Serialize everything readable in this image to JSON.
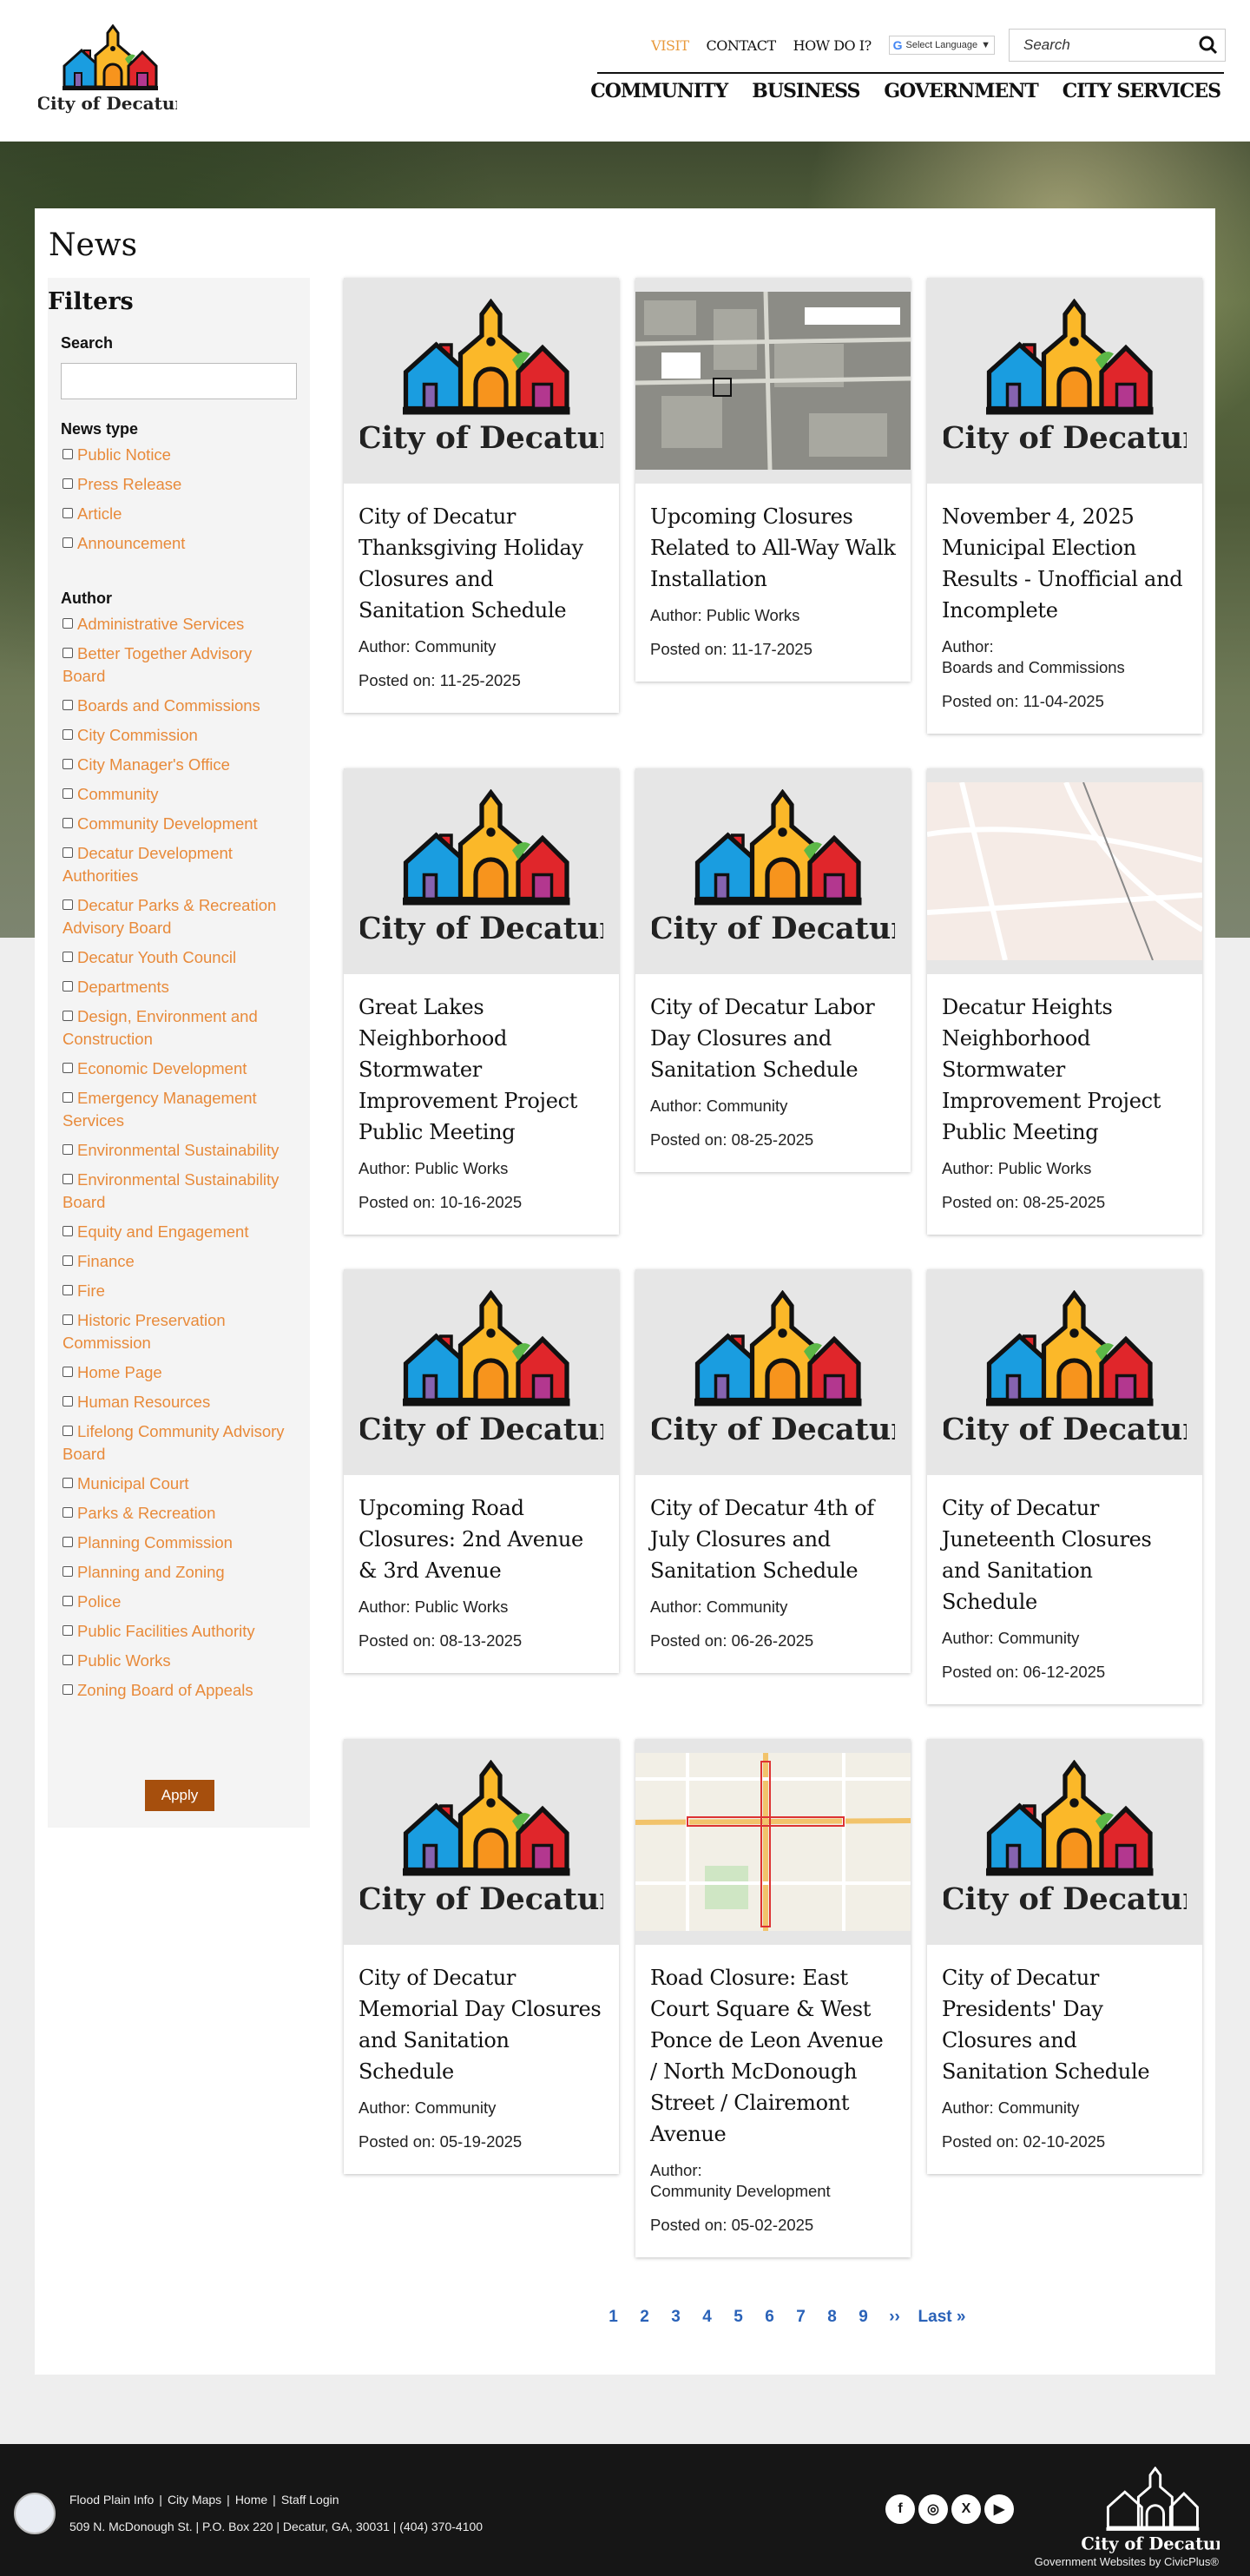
{
  "header": {
    "logo_text": "City of Decatur",
    "utility_links": [
      "VISIT",
      "CONTACT",
      "HOW DO I?"
    ],
    "language_label": "Select Language",
    "search_placeholder": "Search",
    "main_nav": [
      "COMMUNITY",
      "BUSINESS",
      "GOVERNMENT",
      "CITY SERVICES"
    ]
  },
  "page": {
    "title": "News"
  },
  "filters": {
    "title": "Filters",
    "search_label": "Search",
    "search_value": "",
    "news_type_label": "News type",
    "news_types": [
      "Public Notice",
      "Press Release",
      "Article",
      "Announcement"
    ],
    "author_label": "Author",
    "authors": [
      "Administrative Services",
      "Better Together Advisory Board",
      "Boards and Commissions",
      "City Commission",
      "City Manager's Office",
      "Community",
      "Community Development",
      "Decatur Development Authorities",
      "Decatur Parks & Recreation Advisory Board",
      "Decatur Youth Council",
      "Departments",
      "Design, Environment and Construction",
      "Economic Development",
      "Emergency Management Services",
      "Environmental Sustainability",
      "Environmental Sustainability Board",
      "Equity and Engagement",
      "Finance",
      "Fire",
      "Historic Preservation Commission",
      "Home Page",
      "Human Resources",
      "Lifelong Community Advisory Board",
      "Municipal Court",
      "Parks & Recreation",
      "Planning Commission",
      "Planning and Zoning",
      "Police",
      "Public Facilities Authority",
      "Public Works",
      "Zoning Board of Appeals"
    ],
    "apply_label": "Apply"
  },
  "news": [
    {
      "title": "City of Decatur Thanksgiving Holiday Closures and Sanitation Schedule",
      "author": "Author: Community",
      "posted": "Posted on: 11-25-2025",
      "thumb": "logo"
    },
    {
      "title": "Upcoming Closures Related to All-Way Walk Installation",
      "author": "Author: Public Works",
      "posted": "Posted on: 11-17-2025",
      "thumb": "aerial"
    },
    {
      "title": "November 4, 2025 Municipal Election Results - Unofficial and Incomplete",
      "author": "Author:\nBoards and Commissions",
      "posted": "Posted on: 11-04-2025",
      "thumb": "logo"
    },
    {
      "title": "Great Lakes Neighborhood Stormwater Improvement Project Public Meeting",
      "author": "Author: Public Works",
      "posted": "Posted on: 10-16-2025",
      "thumb": "logo"
    },
    {
      "title": "City of Decatur Labor Day Closures and Sanitation Schedule",
      "author": "Author: Community",
      "posted": "Posted on: 08-25-2025",
      "thumb": "logo"
    },
    {
      "title": "Decatur Heights Neighborhood Stormwater Improvement Project Public Meeting",
      "author": "Author: Public Works",
      "posted": "Posted on: 08-25-2025",
      "thumb": "map"
    },
    {
      "title": "Upcoming Road Closures: 2nd Avenue & 3rd Avenue",
      "author": "Author: Public Works",
      "posted": "Posted on: 08-13-2025",
      "thumb": "logo"
    },
    {
      "title": "City of Decatur 4th of July Closures and Sanitation Schedule",
      "author": "Author: Community",
      "posted": "Posted on: 06-26-2025",
      "thumb": "logo"
    },
    {
      "title": "City of Decatur Juneteenth Closures and Sanitation Schedule",
      "author": "Author: Community",
      "posted": "Posted on: 06-12-2025",
      "thumb": "logo"
    },
    {
      "title": "City of Decatur Memorial Day Closures and Sanitation Schedule",
      "author": "Author: Community",
      "posted": "Posted on: 05-19-2025",
      "thumb": "logo"
    },
    {
      "title": "Road Closure: East Court Square & West Ponce de Leon Avenue / North McDonough Street / Clairemont Avenue",
      "author": "Author:\nCommunity Development",
      "posted": "Posted on: 05-02-2025",
      "thumb": "streetmap"
    },
    {
      "title": "City of Decatur Presidents' Day Closures and Sanitation Schedule",
      "author": "Author: Community",
      "posted": "Posted on: 02-10-2025",
      "thumb": "logo"
    }
  ],
  "pagination": {
    "pages": [
      "1",
      "2",
      "3",
      "4",
      "5",
      "6",
      "7",
      "8",
      "9"
    ],
    "next": "››",
    "last": "Last »"
  },
  "footer": {
    "links": [
      "Flood Plain Info",
      "City Maps",
      "Home",
      "Staff Login"
    ],
    "address": "509 N. McDonough St. | P.O. Box 220 | Decatur, GA, 30031 | (404) 370-4100",
    "social": [
      "facebook",
      "instagram",
      "x",
      "youtube"
    ],
    "logo_text": "City of Decatur",
    "credit": "Government Websites by CivicPlus®"
  }
}
